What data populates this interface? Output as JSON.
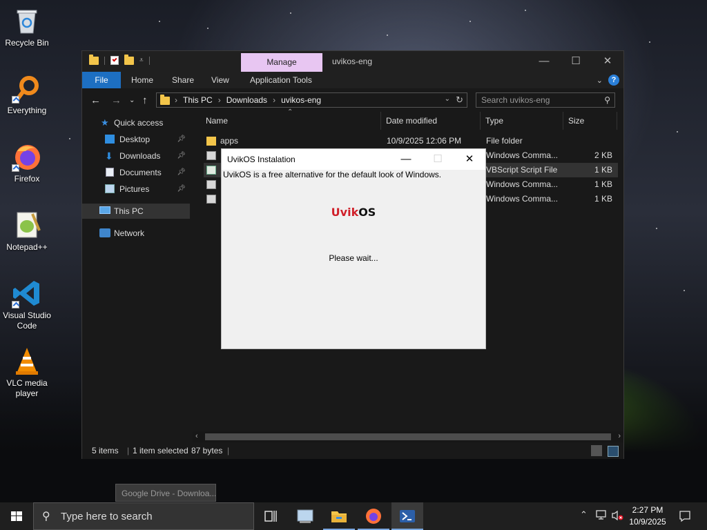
{
  "desktop": {
    "icons": [
      {
        "label": "Recycle Bin"
      },
      {
        "label": "Everything"
      },
      {
        "label": "Firefox"
      },
      {
        "label": "Notepad++"
      },
      {
        "label": "Visual Studio Code"
      },
      {
        "label": "VLC media player"
      }
    ]
  },
  "explorer": {
    "title": "uvikos-eng",
    "manage_tab": "Manage",
    "ribbon_tabs": {
      "file": "File",
      "home": "Home",
      "share": "Share",
      "view": "View",
      "app_tools": "Application Tools"
    },
    "breadcrumb": [
      "This PC",
      "Downloads",
      "uvikos-eng"
    ],
    "search_placeholder": "Search uvikos-eng",
    "nav": {
      "quick_access": "Quick access",
      "desktop": "Desktop",
      "downloads": "Downloads",
      "documents": "Documents",
      "pictures": "Pictures",
      "this_pc": "This PC",
      "network": "Network"
    },
    "columns": {
      "name": "Name",
      "date": "Date modified",
      "type": "Type",
      "size": "Size"
    },
    "files": [
      {
        "name": "apps",
        "date": "10/9/2025 12:06 PM",
        "type": "File folder",
        "size": ""
      },
      {
        "name": "",
        "date": "",
        "type": "Windows Comma...",
        "size": "2 KB"
      },
      {
        "name": "",
        "date": "",
        "type": "VBScript Script File",
        "size": "1 KB"
      },
      {
        "name": "",
        "date": "",
        "type": "Windows Comma...",
        "size": "1 KB"
      },
      {
        "name": "",
        "date": "",
        "type": "Windows Comma...",
        "size": "1 KB"
      }
    ],
    "status": {
      "count": "5 items",
      "selected": "1 item selected",
      "size": "87 bytes"
    }
  },
  "dialog": {
    "title": "UvikOS Instalation",
    "description": "UvikOS is a free alternative for the default look of Windows.",
    "logo_a": "Uvik",
    "logo_b": "OS",
    "wait": "Please wait..."
  },
  "tooltip": "Google Drive - Downloa...",
  "taskbar": {
    "search_placeholder": "Type here to search",
    "time": "2:27 PM",
    "date": "10/9/2025"
  },
  "colors": {
    "accent": "#1d6fc2",
    "manage": "#e8c6f2",
    "logo_red": "#d0202a"
  }
}
